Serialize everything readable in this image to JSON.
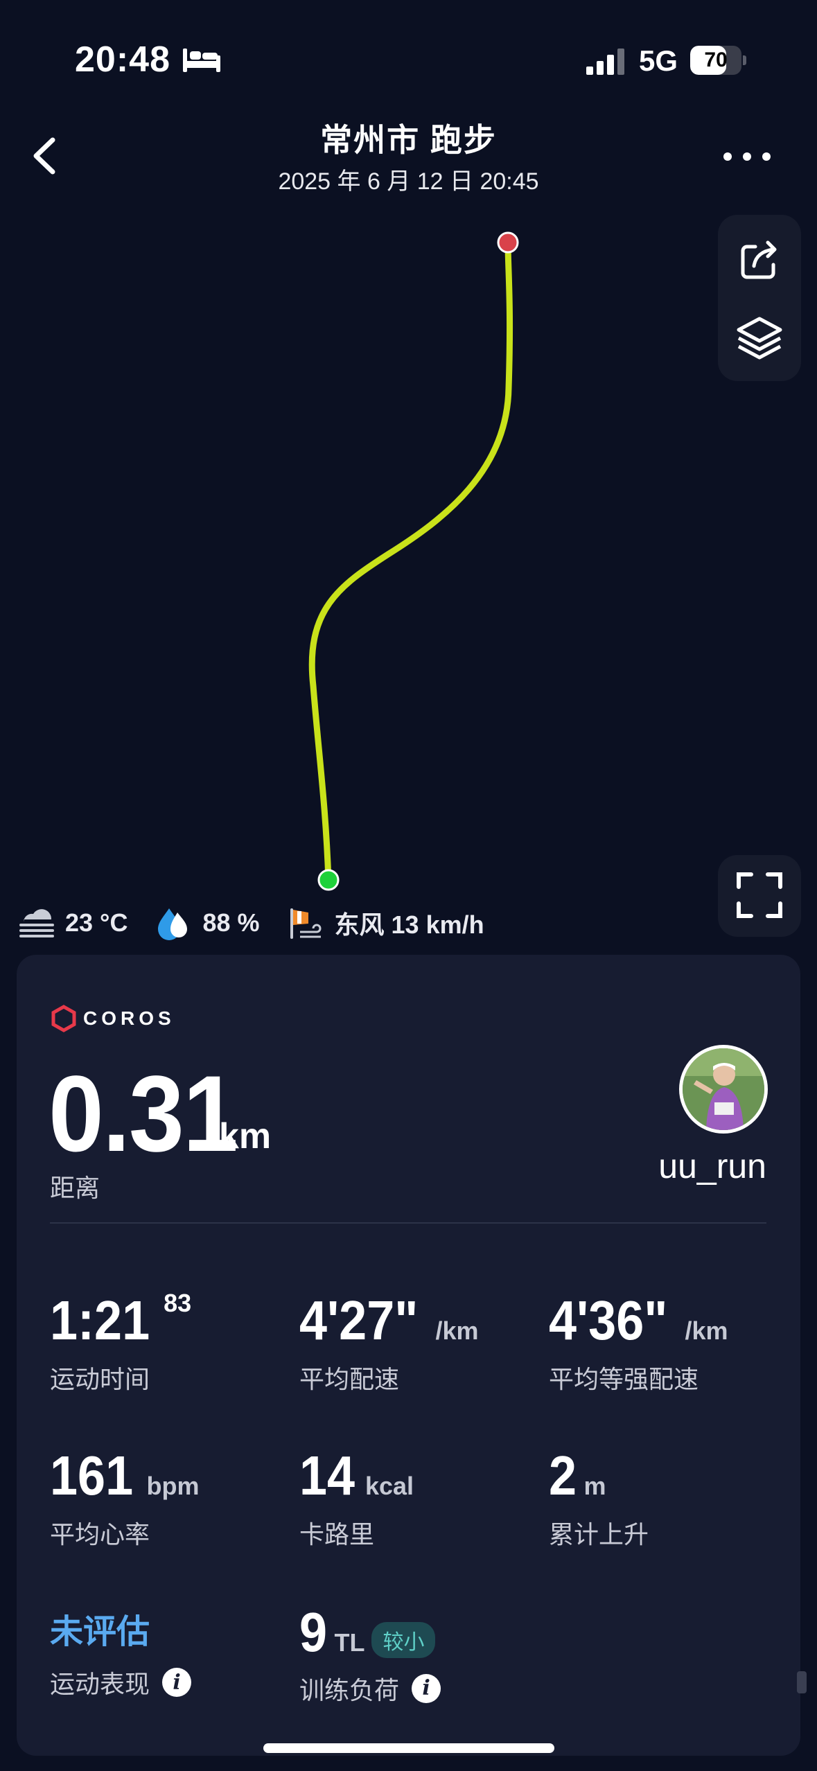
{
  "status_bar": {
    "time": "20:48",
    "network": "5G",
    "battery_percent": "70",
    "battery_level": 0.7,
    "icons": [
      "bed-icon",
      "signal-icon",
      "battery-icon"
    ]
  },
  "header": {
    "title": "常州市 跑步",
    "subtitle": "2025 年 6 月 12 日 20:45",
    "back_icon": "chevron-left-icon",
    "more_icon": "more-dots-icon"
  },
  "map": {
    "tools": [
      "share-icon",
      "layers-icon"
    ],
    "fullscreen_icon": "fullscreen-icon",
    "route_color": "#c9e21a",
    "start_color": "#1ed13a",
    "end_color": "#d9424a"
  },
  "weather": {
    "temperature": "23 °C",
    "humidity": "88 %",
    "wind": "东风 13 km/h"
  },
  "card": {
    "brand": "COROS",
    "brand_color": "#e8394a",
    "distance": {
      "value": "0.31",
      "unit": "km",
      "label": "距离"
    },
    "username": "uu_run",
    "metrics": [
      {
        "value": "1:21",
        "sup": "83",
        "unit": "",
        "label": "运动时间"
      },
      {
        "value": "4'27\"",
        "sup": "",
        "unit": "/km",
        "label": "平均配速"
      },
      {
        "value": "4'36\"",
        "sup": "",
        "unit": "/km",
        "label": "平均等强配速"
      },
      {
        "value": "161",
        "sup": "",
        "unit": "bpm",
        "label": "平均心率"
      },
      {
        "value": "14",
        "sup": "",
        "unit": "kcal",
        "label": "卡路里"
      },
      {
        "value": "2",
        "sup": "",
        "unit": "m",
        "label": "累计上升"
      }
    ],
    "performance": {
      "value": "未评估",
      "label": "运动表现",
      "color": "#5aaaf0"
    },
    "training_load": {
      "value": "9",
      "unit": "TL",
      "badge": "较小",
      "label": "训练负荷"
    }
  }
}
